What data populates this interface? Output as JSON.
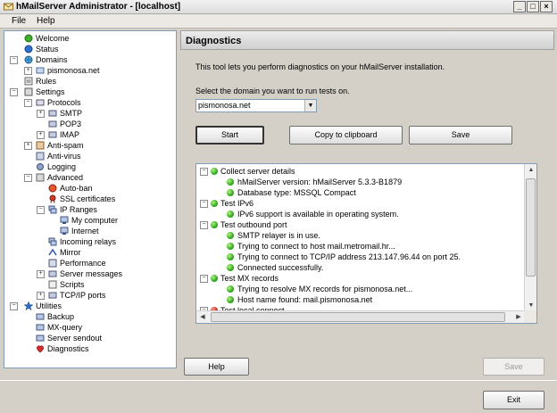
{
  "window": {
    "title": "hMailServer Administrator - [localhost]"
  },
  "menu": {
    "items": [
      "File",
      "Help"
    ]
  },
  "tree": {
    "nodes": [
      {
        "label": "Welcome"
      },
      {
        "label": "Status"
      },
      {
        "label": "Domains"
      },
      {
        "label": "pismonosa.net"
      },
      {
        "label": "Rules"
      },
      {
        "label": "Settings"
      },
      {
        "label": "Protocols"
      },
      {
        "label": "SMTP"
      },
      {
        "label": "POP3"
      },
      {
        "label": "IMAP"
      },
      {
        "label": "Anti-spam"
      },
      {
        "label": "Anti-virus"
      },
      {
        "label": "Logging"
      },
      {
        "label": "Advanced"
      },
      {
        "label": "Auto-ban"
      },
      {
        "label": "SSL certificates"
      },
      {
        "label": "IP Ranges"
      },
      {
        "label": "My computer"
      },
      {
        "label": "Internet"
      },
      {
        "label": "Incoming relays"
      },
      {
        "label": "Mirror"
      },
      {
        "label": "Performance"
      },
      {
        "label": "Server messages"
      },
      {
        "label": "Scripts"
      },
      {
        "label": "TCP/IP ports"
      },
      {
        "label": "Utilities"
      },
      {
        "label": "Backup"
      },
      {
        "label": "MX-query"
      },
      {
        "label": "Server sendout"
      },
      {
        "label": "Diagnostics"
      }
    ]
  },
  "panel": {
    "title": "Diagnostics",
    "description": "This tool lets you perform diagnostics on your hMailServer installation.",
    "select_label": "Select the domain you want to run tests on.",
    "selected_domain": "pismonosa.net",
    "start_label": "Start",
    "copy_label": "Copy to clipboard",
    "save_label": "Save"
  },
  "results": {
    "lines": [
      {
        "text": "Collect server details",
        "status": "ok"
      },
      {
        "text": "hMailServer version: hMailServer 5.3.3-B1879",
        "status": "ok"
      },
      {
        "text": "Database type: MSSQL Compact",
        "status": "ok"
      },
      {
        "text": "Test IPv6",
        "status": "ok"
      },
      {
        "text": "IPv6 support is available in operating system.",
        "status": "ok"
      },
      {
        "text": "Test outbound port",
        "status": "ok"
      },
      {
        "text": "SMTP relayer is in use.",
        "status": "ok"
      },
      {
        "text": "Trying to connect to host mail.metromail.hr...",
        "status": "ok"
      },
      {
        "text": "Trying to connect to TCP/IP address 213.147.96.44 on port 25.",
        "status": "ok"
      },
      {
        "text": "Connected successfully.",
        "status": "ok"
      },
      {
        "text": "Test MX records",
        "status": "ok"
      },
      {
        "text": "Trying to resolve MX records for pismonosa.net...",
        "status": "ok"
      },
      {
        "text": "Host name found: mail.pismonosa.net",
        "status": "ok"
      },
      {
        "text": "Test local connect",
        "status": "fail"
      }
    ]
  },
  "footer": {
    "help_label": "Help",
    "save_label": "Save",
    "exit_label": "Exit"
  }
}
